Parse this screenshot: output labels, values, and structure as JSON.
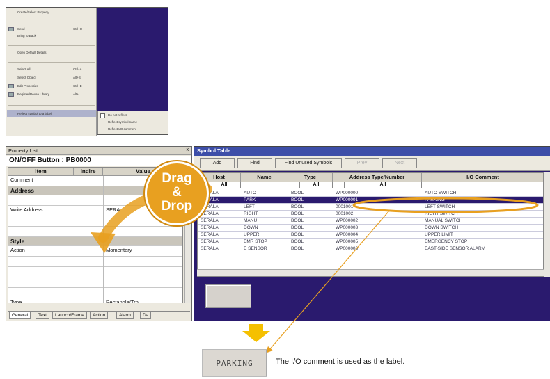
{
  "context_menu": {
    "items": [
      "Create/Select Property",
      "Send",
      "Bring to Back",
      "Open Default Details",
      "Select All",
      "Select Object",
      "Edit Properties",
      "Register/Reuse Library",
      "Reflect symbol to a label"
    ],
    "shortcuts": [
      "",
      "Ctrl+O",
      "",
      "",
      "Ctrl+A",
      "Alt+S",
      "Ctrl+E",
      "Alt+L",
      ""
    ],
    "submenu": [
      "Do not reflect",
      "Reflect symbol name",
      "Reflect I/O comment"
    ]
  },
  "property_list": {
    "title": "Property List",
    "close": "x",
    "object": "ON/OFF Button : PB0000",
    "headers": [
      "Item",
      "Indire",
      "Value"
    ],
    "rows": [
      {
        "label": "Comment",
        "value": "",
        "section": false
      },
      {
        "label": "Address",
        "value": "",
        "section": true
      },
      {
        "label": "",
        "value": "",
        "section": false
      },
      {
        "label": "Write Address",
        "value": "SERA",
        "section": false
      },
      {
        "label": "",
        "value": "",
        "section": false
      },
      {
        "label": "",
        "value": "",
        "section": false
      },
      {
        "label": "Style",
        "value": "",
        "section": true
      },
      {
        "label": "Action",
        "value": "Momentary",
        "section": false
      },
      {
        "label": "",
        "value": "",
        "section": false
      },
      {
        "label": "",
        "value": "",
        "section": false
      },
      {
        "label": "",
        "value": "",
        "section": false
      },
      {
        "label": "",
        "value": "",
        "section": false
      },
      {
        "label": "Type",
        "value": "Rectangle/Trp",
        "section": false
      }
    ],
    "tabs": [
      "General",
      "Text",
      "Launch/Frame",
      "Action",
      "Alarm",
      "Da"
    ]
  },
  "symbol_table": {
    "title": "Symbol Table",
    "toolbar": [
      "Add",
      "Find",
      "Find Unused Symbols",
      "Prev",
      "Next"
    ],
    "headers": [
      "Host",
      "Name",
      "Type",
      "Address Type/Number",
      "I/O Comment"
    ],
    "filters": [
      "All",
      "All",
      "All"
    ],
    "rows": [
      [
        "SERALA",
        "AUTO",
        "BOOL",
        "WP000000",
        "AUTO SWITCH"
      ],
      [
        "SERALA",
        "PARK",
        "BOOL",
        "WP000001",
        "PARKING"
      ],
      [
        "SERALA",
        "LEFT",
        "BOOL",
        "0001001",
        "LEFT SWITCH"
      ],
      [
        "SERALA",
        "RIGHT",
        "BOOL",
        "0001002",
        "RIGHT SWITCH"
      ],
      [
        "SERALA",
        "MANU",
        "BOOL",
        "WP000002",
        "MANUAL SWITCH"
      ],
      [
        "SERALA",
        "DOWN",
        "BOOL",
        "WP000003",
        "DOWN SWITCH"
      ],
      [
        "SERALA",
        "UPPER",
        "BOOL",
        "WP000004",
        "UPPER LIMIT"
      ],
      [
        "SERALA",
        "EMR STOP",
        "BOOL",
        "WP000005",
        "EMERGENCY STOP"
      ],
      [
        "SERALA",
        "E SENSOR",
        "BOOL",
        "WP000006",
        "EAST-SIDE SENSOR ALARM"
      ]
    ],
    "selected_row": 1
  },
  "drag_drop": {
    "line1": "Drag",
    "line2": "&",
    "line3": "Drop"
  },
  "result": {
    "label": "PARKING",
    "caption": "The I/O comment is used as the label."
  },
  "colors": {
    "accent": "#e8a020",
    "selection": "#2a1a6e",
    "title_bar": "#3d4ea8"
  }
}
